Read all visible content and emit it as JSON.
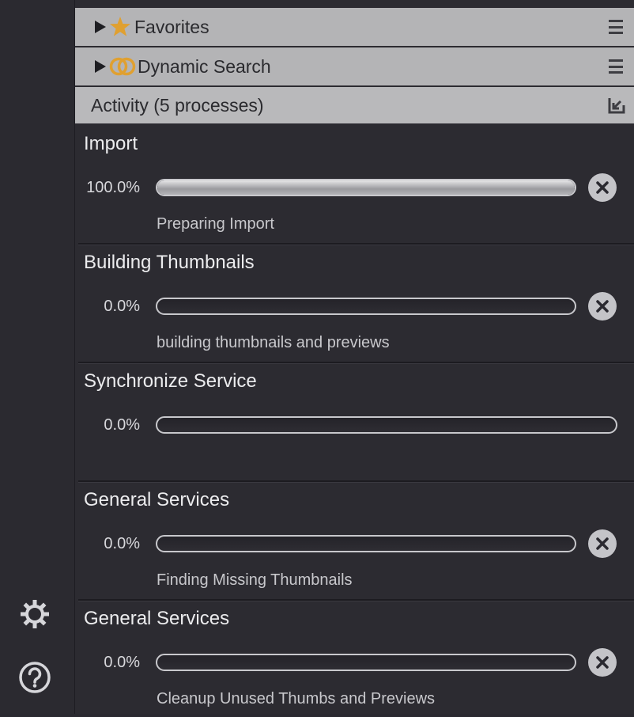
{
  "sidebar": {
    "settings_icon": "gear-icon",
    "help_icon": "question-circle-icon"
  },
  "sections": {
    "favorites": {
      "label": "Favorites",
      "icon": "star-icon",
      "icon_color": "#e0a030"
    },
    "dynamic_search": {
      "label": "Dynamic Search",
      "icon": "interlocking-rings-icon",
      "icon_color": "#e0a030"
    },
    "activity": {
      "label": "Activity (5 processes)",
      "icon": "collapse-arrow-icon"
    }
  },
  "processes": [
    {
      "title": "Import",
      "percent": "100.0%",
      "progress": 1.0,
      "status": "Preparing Import",
      "cancellable": true
    },
    {
      "title": "Building Thumbnails",
      "percent": "0.0%",
      "progress": 0.0,
      "status": "building thumbnails and previews",
      "cancellable": true
    },
    {
      "title": "Synchronize Service",
      "percent": "0.0%",
      "progress": 0.0,
      "status": "",
      "cancellable": false
    },
    {
      "title": "General Services",
      "percent": "0.0%",
      "progress": 0.0,
      "status": "Finding Missing Thumbnails",
      "cancellable": true
    },
    {
      "title": "General Services",
      "percent": "0.0%",
      "progress": 0.0,
      "status": "Cleanup Unused Thumbs and Previews",
      "cancellable": true
    }
  ],
  "colors": {
    "accent": "#e0a030",
    "header_bg": "#b4b4b6",
    "panel_bg": "#2c2b31"
  }
}
